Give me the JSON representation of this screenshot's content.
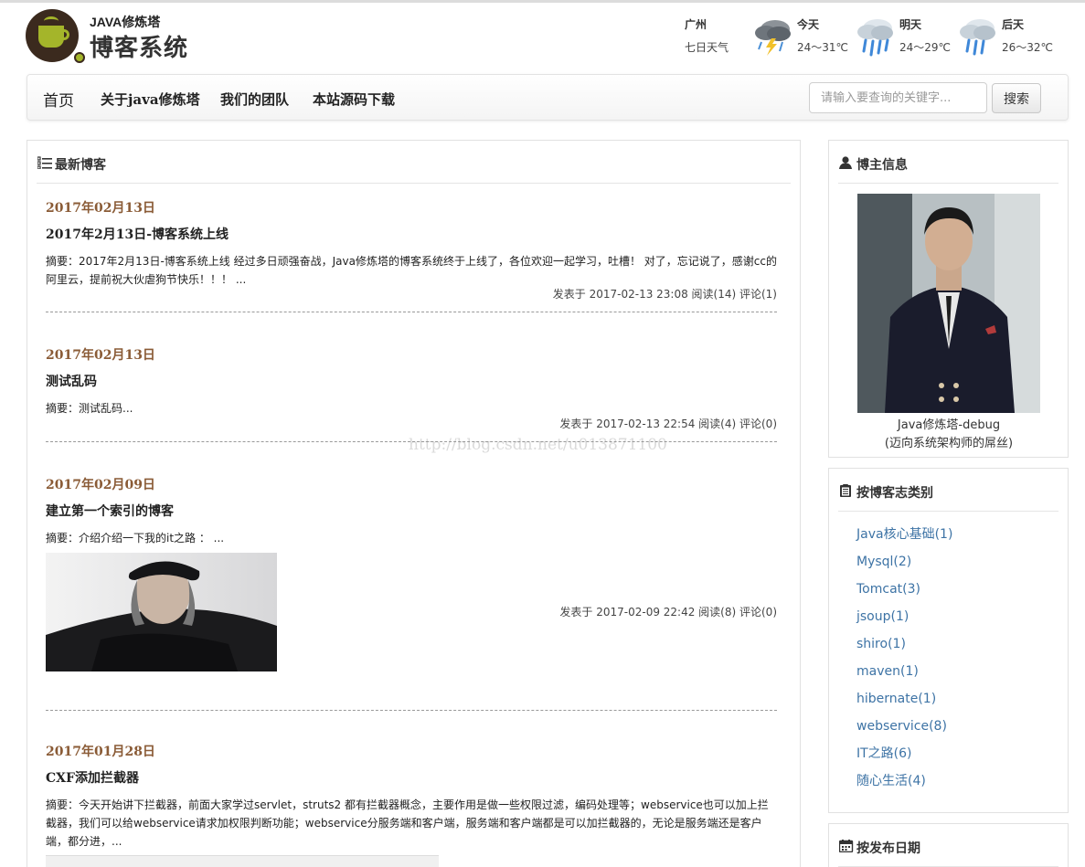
{
  "header": {
    "logo_small": "JAVA修炼塔",
    "logo_big": "博客系统",
    "weather": {
      "city": "广州",
      "subtitle": "七日天气",
      "days": [
        {
          "label": "今天",
          "temp": "24～31℃",
          "icon": "thunderstorm-icon"
        },
        {
          "label": "明天",
          "temp": "24～29℃",
          "icon": "rain-icon"
        },
        {
          "label": "后天",
          "temp": "26～32℃",
          "icon": "rain-icon"
        }
      ]
    }
  },
  "nav": {
    "items": [
      "首页",
      "关于java修炼塔",
      "我们的团队",
      "本站源码下载"
    ],
    "search_placeholder": "请输入要查询的关键字...",
    "search_button": "搜索"
  },
  "main": {
    "section_title": "最新博客",
    "section_icon": "list-icon",
    "blogs": [
      {
        "date": "2017年02月13日",
        "title": "2017年2月13日-博客系统上线",
        "summary": "摘要：2017年2月13日-博客系统上线 经过多日顽强奋战，Java修炼塔的博客系统终于上线了，各位欢迎一起学习，吐槽！ 对了，忘记说了，感谢cc的阿里云，提前祝大伙虐狗节快乐！！！ ...",
        "meta": "发表于 2017-02-13 23:08 阅读(14) 评论(1)"
      },
      {
        "date": "2017年02月13日",
        "title": "测试乱码",
        "summary": "摘要：测试乱码...",
        "meta": "发表于 2017-02-13 22:54 阅读(4) 评论(0)"
      },
      {
        "date": "2017年02月09日",
        "title": "建立第一个索引的博客",
        "summary": "摘要：介绍介绍一下我的it之路 ： ...",
        "meta": "发表于 2017-02-09 22:42 阅读(8) 评论(0)"
      },
      {
        "date": "2017年01月28日",
        "title": "CXF添加拦截器",
        "summary": "摘要：今天开始讲下拦截器，前面大家学过servlet，struts2 都有拦截器概念，主要作用是做一些权限过滤，编码处理等；webservice也可以加上拦截器，我们可以给webservice请求加权限判断功能；webservice分服务端和客户端，服务端和客户端都是可以加拦截器的，无论是服务端还是客户端，都分进，...",
        "meta": ""
      }
    ],
    "watermark": "http://blog.csdn.net/u013871100"
  },
  "sidebar": {
    "blogger": {
      "title": "博主信息",
      "icon": "user-icon",
      "name": "Java修炼塔-debug",
      "motto": "(迈向系统架构师的屌丝)"
    },
    "categories": {
      "title": "按博客志类别",
      "icon": "clipboard-icon",
      "items": [
        "Java核心基础(1)",
        "Mysql(2)",
        "Tomcat(3)",
        "jsoup(1)",
        "shiro(1)",
        "maven(1)",
        "hibernate(1)",
        "webservice(8)",
        "IT之路(6)",
        "随心生活(4)"
      ]
    },
    "dates": {
      "title": "按发布日期",
      "icon": "calendar-icon"
    }
  },
  "colors": {
    "date": "#8a5b36",
    "link": "#3d73a5",
    "logo_brown": "#3b2a1e",
    "logo_green": "#a4b52a"
  }
}
